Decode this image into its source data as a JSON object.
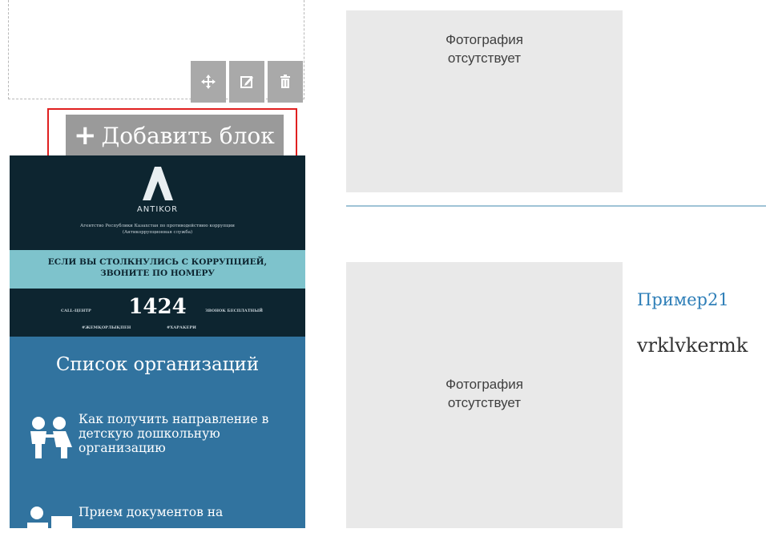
{
  "editor": {
    "add_block_label": "Добавить блок",
    "tools": [
      "move-icon",
      "edit-icon",
      "trash-icon"
    ]
  },
  "banner": {
    "brand": "ANTIKOR",
    "agency_line1": "Агентство Республики Казахстан по противодействию коррупции",
    "agency_line2": "(Антикоррупционная служба)",
    "stripe_line1": "ЕСЛИ ВЫ СТОЛКНУЛИСЬ С КОРРУПЦИЕЙ,",
    "stripe_line2": "ЗВОНИТЕ ПО НОМЕРУ",
    "phone": "1424",
    "call_center": "CALL-ЦЕНТР",
    "free_call": "ЗВОНОК БЕСПЛАТНЫЙ",
    "hashtag1": "#ЖЕМҚОРЛЫҚПЕН",
    "hashtag2": "#ХАРАКЕРИ"
  },
  "org_panel": {
    "title": "Список организаций",
    "items": [
      {
        "label": "Как получить направление в детскую дошкольную организацию",
        "icon": "children-icon"
      },
      {
        "label": "Прием документов на",
        "icon": "teacher-icon"
      }
    ]
  },
  "listing": {
    "photo_placeholder_line1": "Фотография",
    "photo_placeholder_line2": "отсутствует",
    "item_title": "Пример21",
    "item_text": "vrklvkermk"
  },
  "colors": {
    "highlight": "#e02020",
    "banner_bg": "#0d2530",
    "stripe": "#7ec3cc",
    "org_panel": "#31739f",
    "link": "#2f7fb8"
  }
}
